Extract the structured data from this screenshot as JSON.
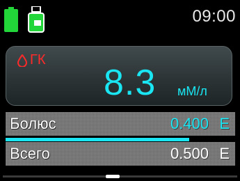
{
  "status_bar": {
    "time": "09:00",
    "battery_icon": "battery-full-icon",
    "reservoir_icon": "insulin-reservoir-icon"
  },
  "glucose_panel": {
    "label": "ГК",
    "icon": "blood-drop-icon",
    "value": "8.3",
    "unit": "мМ/л"
  },
  "bolus_row": {
    "label": "Болюс",
    "value": "0.400",
    "unit": "Е",
    "progress": 0.8
  },
  "total_row": {
    "label": "Всего",
    "value": "0.500",
    "unit": "Е"
  },
  "colors": {
    "accent": "#19e6f2",
    "alert": "#ff2a2a",
    "battery": "#22d63a"
  }
}
